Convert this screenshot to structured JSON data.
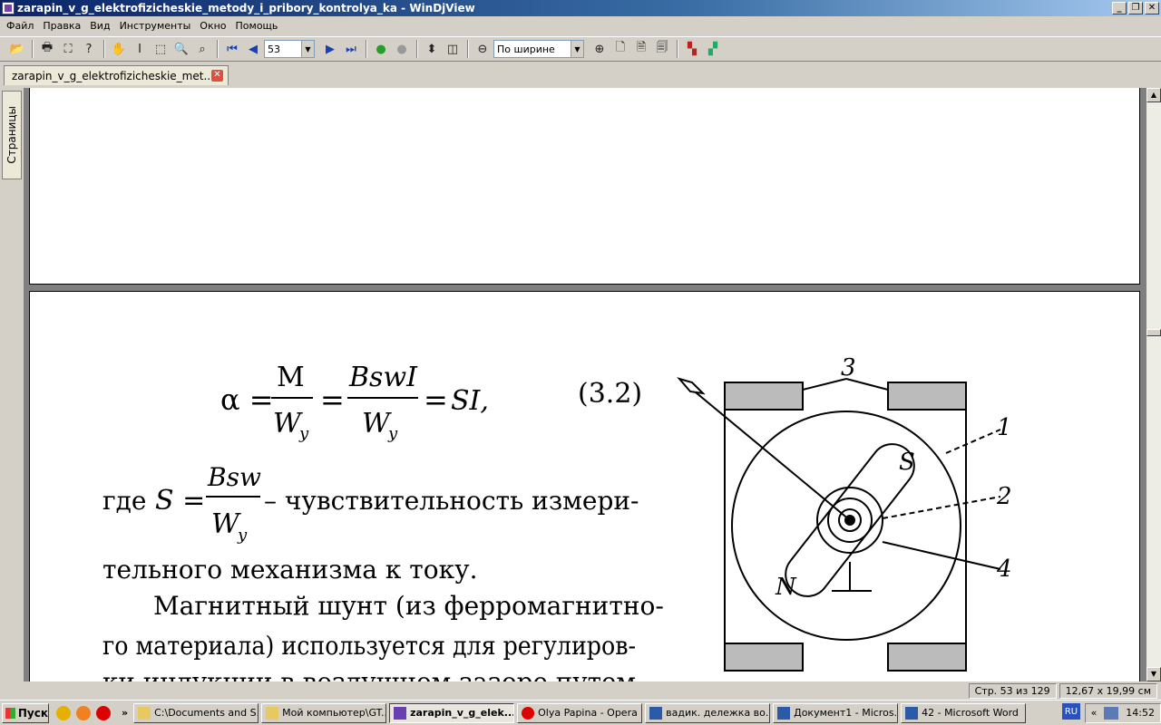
{
  "window": {
    "title": "zarapin_v_g_elektrofizicheskie_metody_i_pribory_kontrolya_ka - WinDjView"
  },
  "menu": [
    "Файл",
    "Правка",
    "Вид",
    "Инструменты",
    "Окно",
    "Помощь"
  ],
  "toolbar": {
    "page_number": "53",
    "zoom": "По ширине"
  },
  "tab": {
    "label": "zarapin_v_g_elektrofizicheskie_met...",
    "close": "✕"
  },
  "sidebar": {
    "pages_tab": "Страницы"
  },
  "document": {
    "formula_number": "(3.2)",
    "where": "где",
    "text_after_formula": "– чувствительность измери-",
    "lines": [
      "тельного механизма к току.",
      "Магнитный шунт (из ферромагнитно-",
      "го материала) используется для регулиров-",
      "ки индукции в воздушном зазоре путем"
    ],
    "figure_labels": [
      "3",
      "1",
      "2",
      "4",
      "S",
      "N"
    ]
  },
  "status": {
    "page_info": "Стр. 53 из 129",
    "page_size": "12,67 x 19,99 см"
  },
  "taskbar": {
    "start": "Пуск",
    "chevron": "»",
    "tasks": [
      "C:\\Documents and S...",
      "Мой компьютер\\GT...",
      "zarapin_v_g_elek...",
      "Olya Papina - Opera",
      "вадик. дележка во...",
      "Документ1 - Micros...",
      "42 - Microsoft Word"
    ],
    "lang": "RU",
    "tray_chevron": "«",
    "clock": "14:52"
  },
  "colors": {
    "titlebar": "#0a246a",
    "face": "#d4d0c8",
    "viewer_bg": "#808080"
  }
}
